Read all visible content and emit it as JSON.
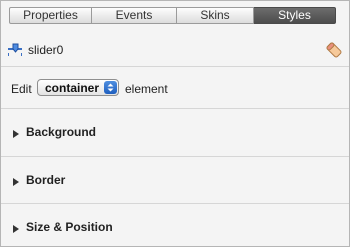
{
  "tabs": [
    {
      "label": "Properties",
      "active": false
    },
    {
      "label": "Events",
      "active": false
    },
    {
      "label": "Skins",
      "active": false
    },
    {
      "label": "Styles",
      "active": true
    }
  ],
  "object": {
    "name": "slider0",
    "icon": "slider-icon",
    "action_icon": "eraser-icon"
  },
  "edit_row": {
    "prefix": "Edit",
    "selected": "container",
    "suffix": "element"
  },
  "sections": [
    {
      "label": "Background",
      "icon": "disclosure-triangle-icon"
    },
    {
      "label": "Border",
      "icon": "disclosure-triangle-icon"
    },
    {
      "label": "Size & Position",
      "icon": "disclosure-triangle-icon"
    }
  ],
  "colors": {
    "active_tab": "#5a5a5a",
    "select_arrow": "#2f6fd0",
    "panel_bg": "#f4f4f4"
  }
}
